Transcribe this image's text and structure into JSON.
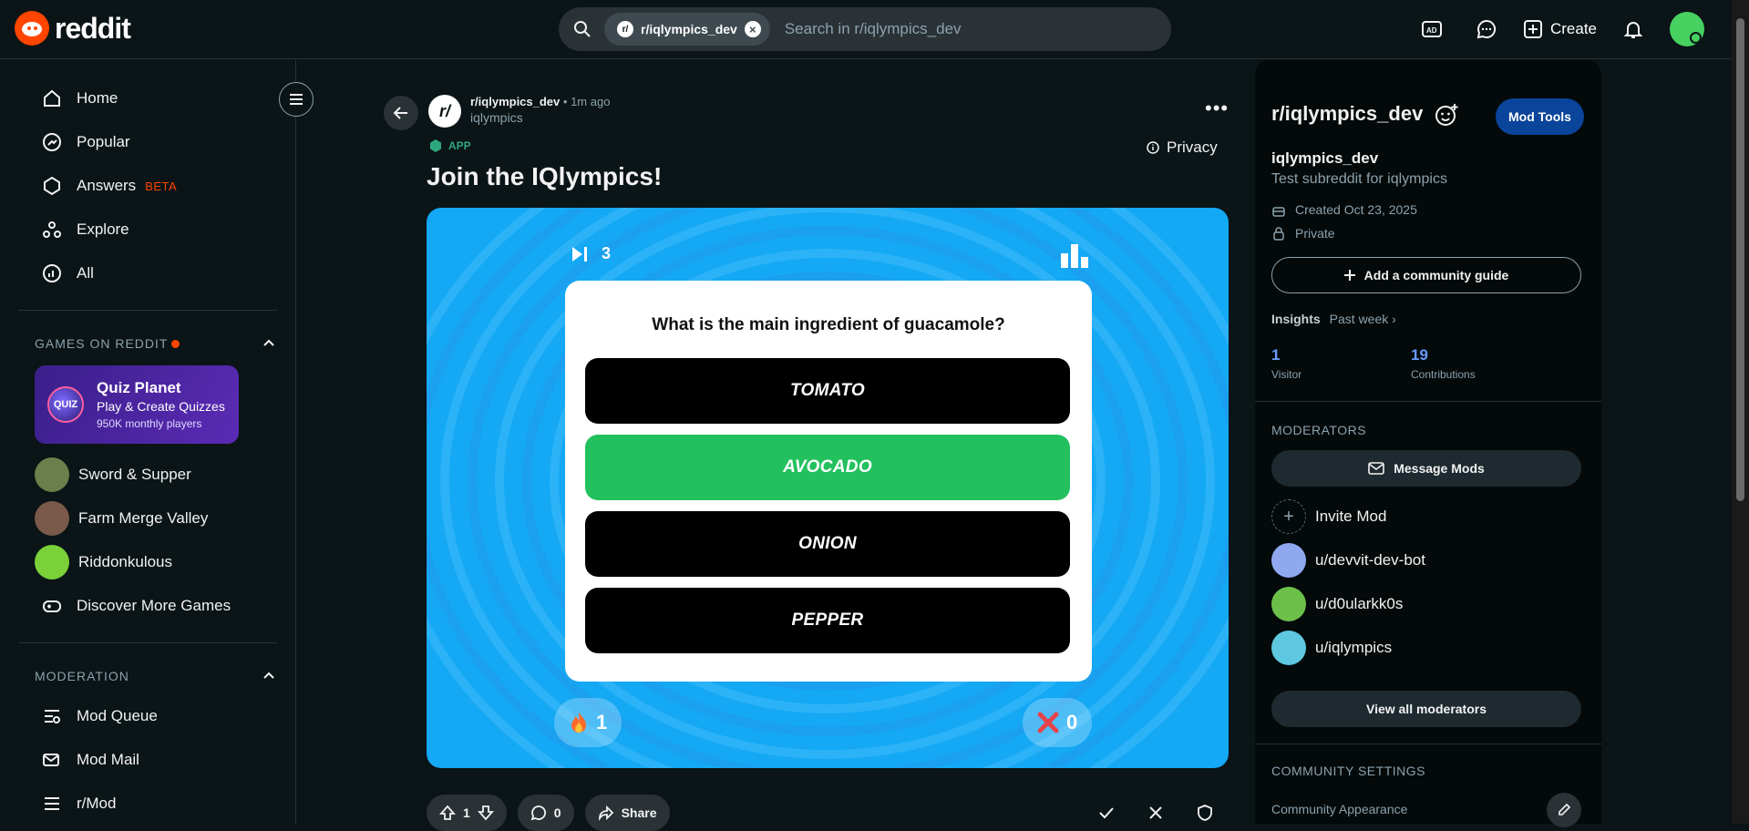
{
  "header": {
    "logo_text": "reddit",
    "search_chip": "r/iqlympics_dev",
    "search_placeholder": "Search in r/iqlympics_dev",
    "create_label": "Create"
  },
  "sidebar": {
    "nav": [
      {
        "label": "Home",
        "icon": "home-icon"
      },
      {
        "label": "Popular",
        "icon": "popular-icon"
      },
      {
        "label": "Answers",
        "icon": "answers-icon",
        "badge": "BETA"
      },
      {
        "label": "Explore",
        "icon": "explore-icon"
      },
      {
        "label": "All",
        "icon": "all-icon"
      }
    ],
    "games_header": "GAMES ON REDDIT",
    "featured_game": {
      "title": "Quiz Planet",
      "subtitle": "Play & Create Quizzes",
      "players": "950K monthly players",
      "logo_text": "QUIZ"
    },
    "games": [
      {
        "label": "Sword & Supper",
        "color": "#6a7f4a"
      },
      {
        "label": "Farm Merge Valley",
        "color": "#7a5a4a"
      },
      {
        "label": "Riddonkulous",
        "color": "#7ad13a"
      }
    ],
    "discover_label": "Discover More Games",
    "moderation_header": "MODERATION",
    "mod_items": [
      {
        "label": "Mod Queue"
      },
      {
        "label": "Mod Mail"
      },
      {
        "label": "r/Mod"
      }
    ]
  },
  "post": {
    "subreddit": "r/iqlympics_dev",
    "time": "• 1m ago",
    "user": "iqlympics",
    "app_badge": "APP",
    "privacy_label": "Privacy",
    "title": "Join the IQlympics!",
    "game": {
      "skip_count": "3",
      "question": "What is the main ingredient of guacamole?",
      "answers": [
        "TOMATO",
        "AVOCADO",
        "ONION",
        "PEPPER"
      ],
      "correct_index": 1,
      "streak": "1",
      "wrong": "0"
    },
    "votes": "1",
    "comments": "0",
    "share_label": "Share"
  },
  "right": {
    "title": "r/iqlympics_dev",
    "mod_tools_label": "Mod Tools",
    "name": "iqlympics_dev",
    "description": "Test subreddit for iqlympics",
    "created": "Created Oct 23, 2025",
    "privacy": "Private",
    "guide_label": "Add a community guide",
    "insights_label": "Insights",
    "insights_period": "Past week ›",
    "visitors": {
      "value": "1",
      "label": "Visitor"
    },
    "contributions": {
      "value": "19",
      "label": "Contributions"
    },
    "moderators_header": "MODERATORS",
    "message_mods_label": "Message Mods",
    "invite_mod_label": "Invite Mod",
    "moderators": [
      {
        "name": "u/devvit-dev-bot",
        "color": "#8fa8f0"
      },
      {
        "name": "u/d0ularkk0s",
        "color": "#6cc04a"
      },
      {
        "name": "u/iqlympics",
        "color": "#5ec8e0"
      }
    ],
    "view_all_label": "View all moderators",
    "settings_header": "COMMUNITY SETTINGS",
    "appearance_label": "Community Appearance"
  }
}
